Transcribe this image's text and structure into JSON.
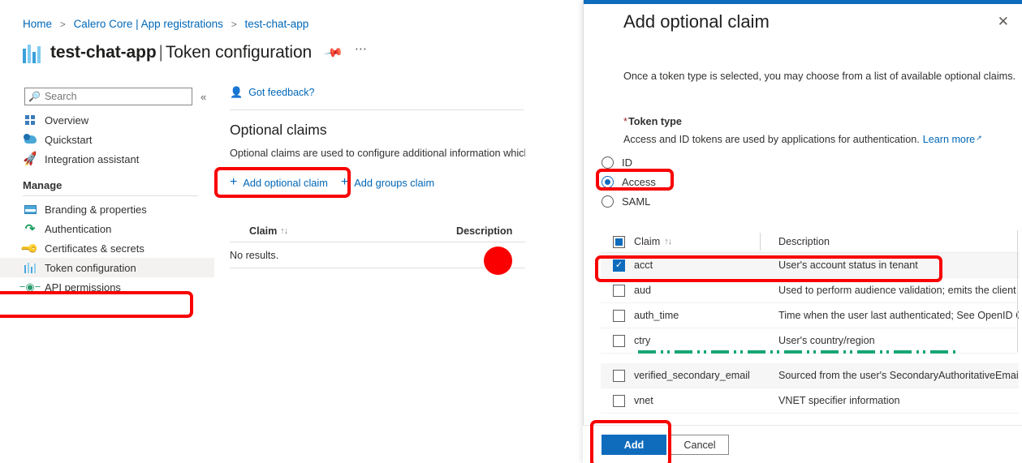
{
  "breadcrumb": {
    "items": [
      "Home",
      "Calero Core | App registrations",
      "test-chat-app"
    ],
    "separator": ">"
  },
  "header": {
    "app_icon": "token-bars-icon",
    "title_app": "test-chat-app",
    "title_separator": "|",
    "title_page": "Token configuration",
    "pin_icon": "pin-icon",
    "more_icon": "ellipsis-icon"
  },
  "sidebar": {
    "search": {
      "placeholder": "Search",
      "value": "",
      "icon": "search-icon"
    },
    "collapse_icon": "«",
    "items": [
      {
        "label": "Overview",
        "icon": "grid-icon",
        "type": "item"
      },
      {
        "label": "Quickstart",
        "icon": "cloud-icon",
        "type": "item"
      },
      {
        "label": "Integration assistant",
        "icon": "rocket-icon",
        "type": "item"
      },
      {
        "label": "Manage",
        "type": "section"
      },
      {
        "label": "Branding & properties",
        "icon": "branding-icon",
        "type": "item"
      },
      {
        "label": "Authentication",
        "icon": "authentication-icon",
        "type": "item"
      },
      {
        "label": "Certificates & secrets",
        "icon": "key-icon",
        "type": "item"
      },
      {
        "label": "Token configuration",
        "icon": "token-bars-icon",
        "type": "item",
        "selected": true
      },
      {
        "label": "API permissions",
        "icon": "api-permissions-icon",
        "type": "item"
      }
    ]
  },
  "main": {
    "feedback": {
      "label": "Got feedback?",
      "icon": "feedback-icon"
    },
    "section_title": "Optional claims",
    "section_desc": "Optional claims are used to configure additional information which",
    "commands": [
      {
        "label": "Add optional claim",
        "icon": "plus-icon"
      },
      {
        "label": "Add groups claim",
        "icon": "plus-icon"
      }
    ],
    "table": {
      "columns": [
        "Claim",
        "Description"
      ],
      "sort_indicator": "↑↓",
      "empty_message": "No results."
    }
  },
  "blade": {
    "title": "Add optional claim",
    "close_icon": "close-icon",
    "intro": "Once a token type is selected, you may choose from a list of available optional claims.",
    "token_type_label": "Token type",
    "required_marker": "*",
    "token_type_desc": "Access and ID tokens are used by applications for authentication.",
    "learn_more": "Learn more",
    "learn_more_icon": "external-link-icon",
    "token_types": [
      {
        "label": "ID",
        "selected": false
      },
      {
        "label": "Access",
        "selected": true
      },
      {
        "label": "SAML",
        "selected": false
      }
    ],
    "picker": {
      "columns": [
        "Claim",
        "Description"
      ],
      "sort_indicator": "↑↓",
      "header_checkbox_state": "indeterminate",
      "rows_top": [
        {
          "claim": "acct",
          "description": "User's account status in tenant",
          "checked": true
        },
        {
          "claim": "aud",
          "description": "Used to perform audience validation; emits the client ID...",
          "checked": false
        },
        {
          "claim": "auth_time",
          "description": "Time when the user last authenticated; See OpenID Con...",
          "checked": false
        },
        {
          "claim": "ctry",
          "description": "User's country/region",
          "checked": false
        }
      ],
      "rows_bottom": [
        {
          "claim": "verified_secondary_email",
          "description": "Sourced from the user's SecondaryAuthoritativeEmail",
          "checked": false
        },
        {
          "claim": "vnet",
          "description": "VNET specifier information",
          "checked": false
        }
      ]
    },
    "footer": {
      "add_label": "Add",
      "cancel_label": "Cancel"
    }
  },
  "annotations": {
    "accent_red": "#f80000",
    "elision_green": "#17a673",
    "boxes": [
      "token-configuration-nav",
      "add-optional-claim-button",
      "access-radio",
      "acct-claim-row",
      "add-button"
    ],
    "dot": "description-column-marker"
  }
}
